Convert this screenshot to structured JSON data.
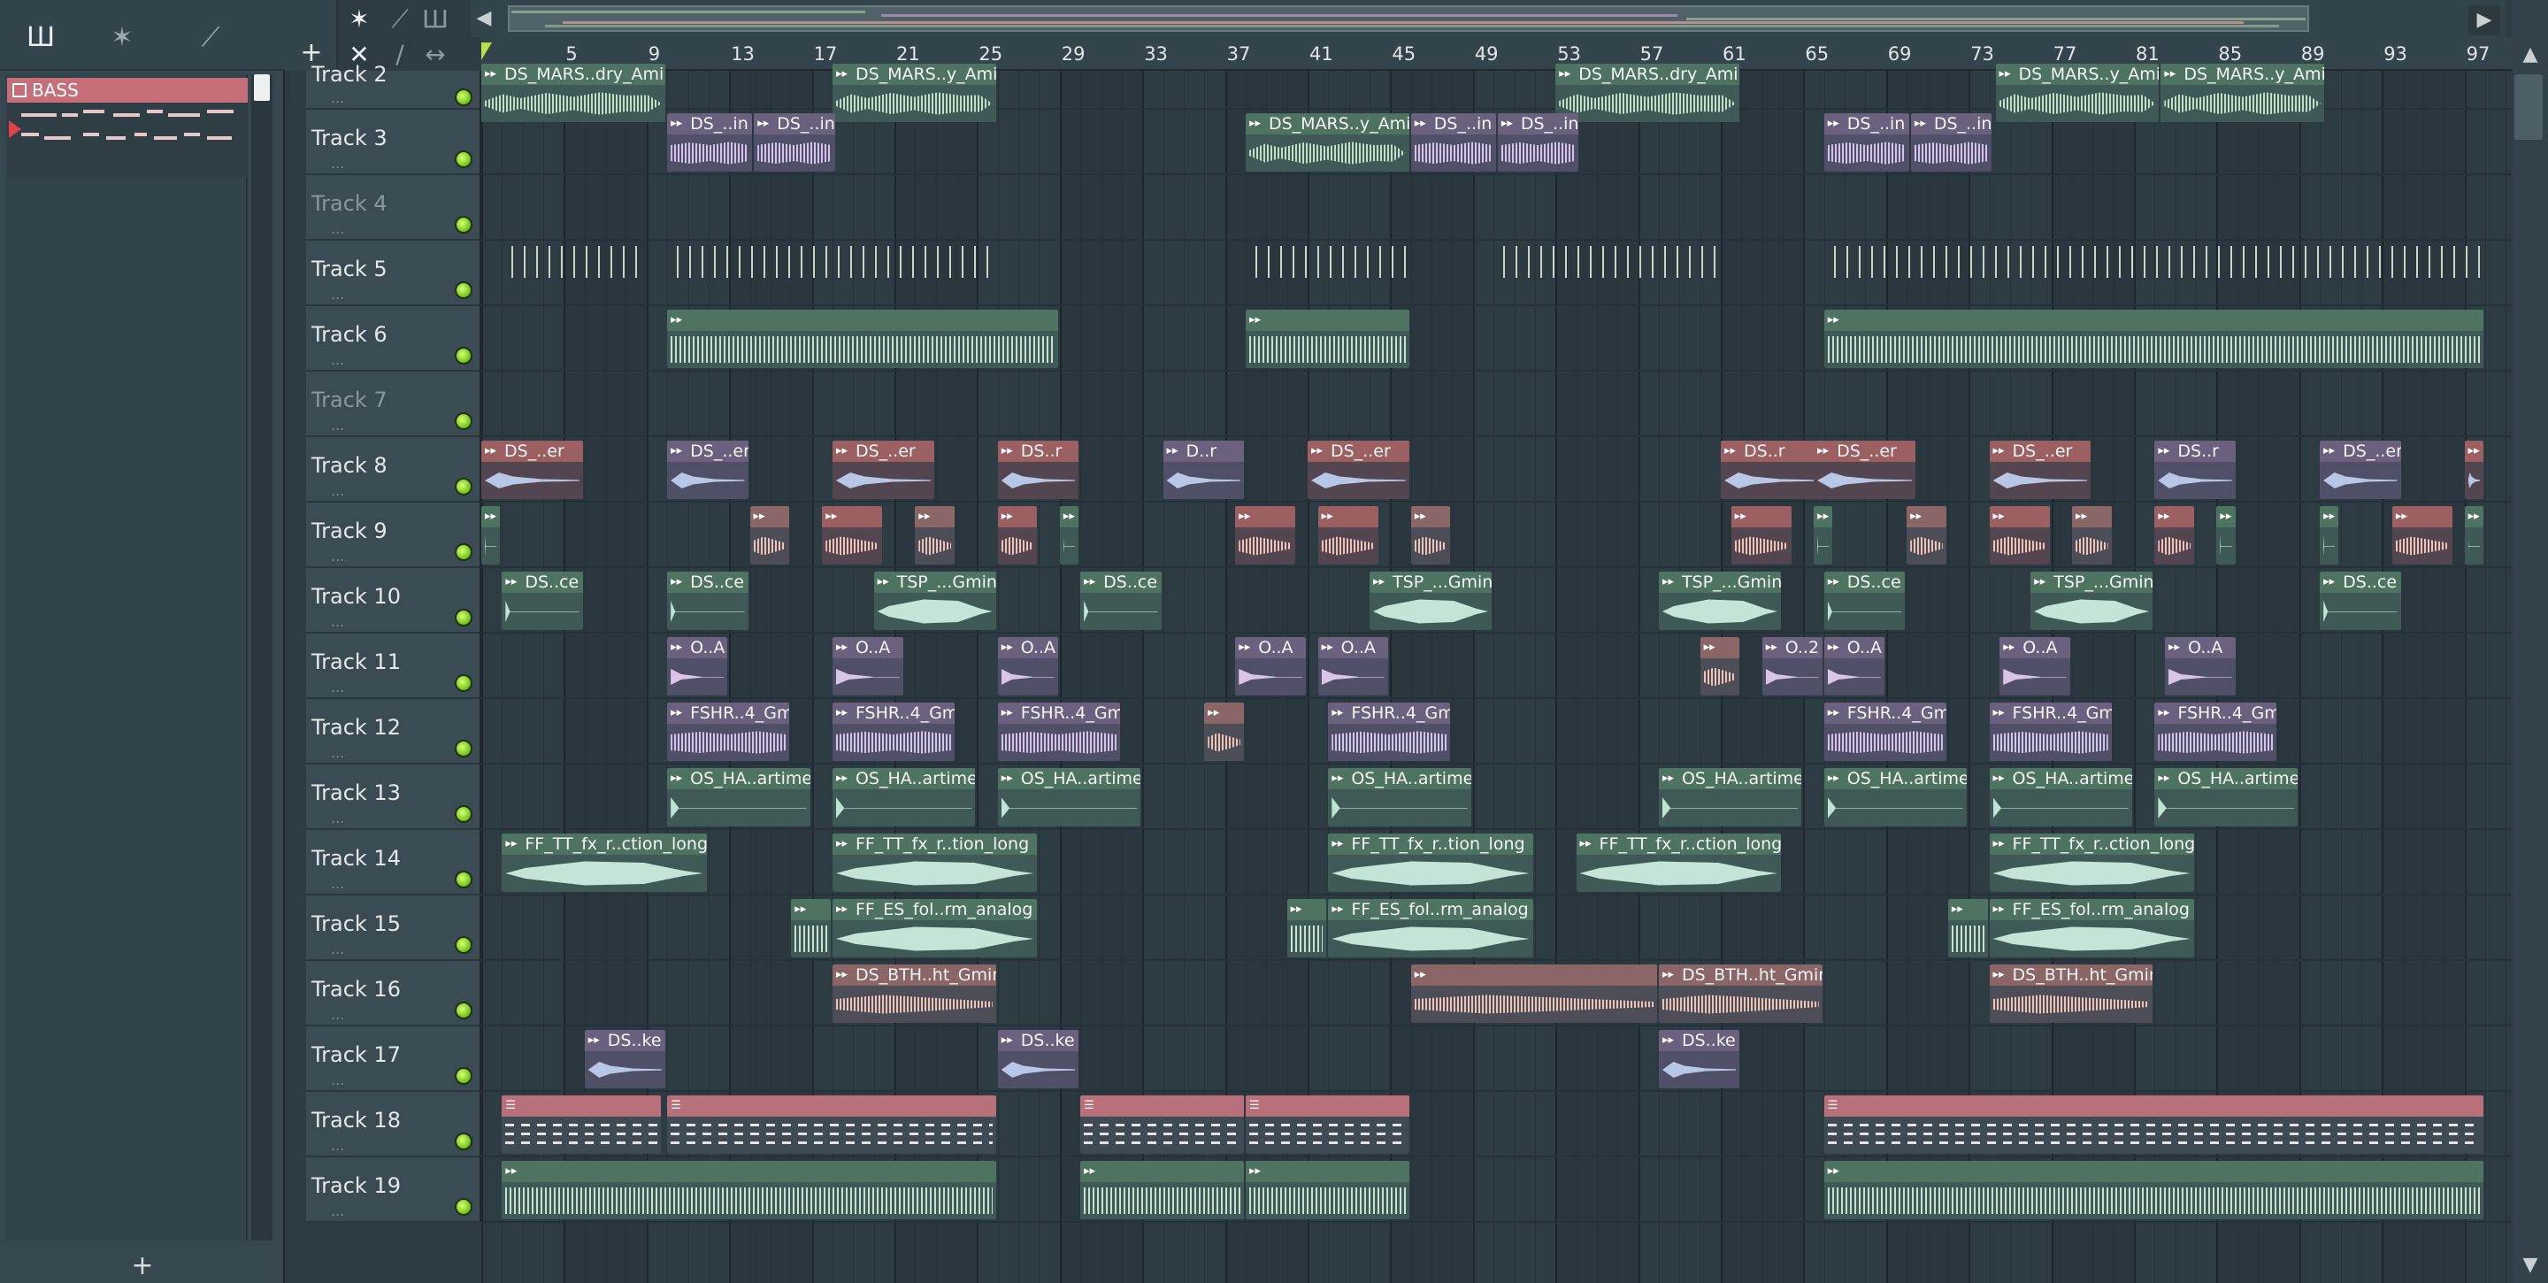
{
  "picker": {
    "tools": [
      "piano-roll",
      "audio",
      "automation"
    ],
    "pattern": {
      "name": "BASS"
    },
    "add_label": "+"
  },
  "playlist": {
    "tools_top": [
      "waveform-tool",
      "automation-tool",
      "piano-roll-tool"
    ],
    "tools_bottom": [
      "close",
      "draw",
      "slide"
    ],
    "add_label": "+",
    "ruler_bars": [
      "5",
      "9",
      "13",
      "17",
      "21",
      "25",
      "29",
      "33",
      "37",
      "41",
      "45",
      "49",
      "53",
      "57",
      "61",
      "65",
      "69",
      "73",
      "77",
      "81",
      "85",
      "89",
      "93",
      "97"
    ]
  },
  "tracks": [
    {
      "name": "Track 2",
      "muted": false,
      "clips": [
        {
          "start": 1,
          "len": 9,
          "label": "DS_MARS..dry_Amin",
          "color": "green",
          "wave": "green"
        },
        {
          "start": 18,
          "len": 8,
          "label": "DS_MARS..y_Amin",
          "color": "green",
          "wave": "green"
        },
        {
          "start": 53,
          "len": 9,
          "label": "DS_MARS..dry_Amin",
          "color": "green",
          "wave": "green"
        },
        {
          "start": 74.3,
          "len": 8,
          "label": "DS_MARS..y_Amin",
          "color": "green",
          "wave": "green"
        },
        {
          "start": 82.3,
          "len": 8,
          "label": "DS_MARS..y_Amin",
          "color": "green",
          "wave": "green"
        }
      ]
    },
    {
      "name": "Track 3",
      "muted": false,
      "clips": [
        {
          "start": 10,
          "len": 4.2,
          "label": "DS_..in",
          "color": "purple",
          "wave": "purple"
        },
        {
          "start": 14.2,
          "len": 4,
          "label": "DS_..in",
          "color": "purple",
          "wave": "purple"
        },
        {
          "start": 38,
          "len": 8,
          "label": "DS_MARS..y_Amin",
          "color": "green",
          "wave": "green"
        },
        {
          "start": 46,
          "len": 4.2,
          "label": "DS_..in",
          "color": "purple",
          "wave": "purple"
        },
        {
          "start": 50.2,
          "len": 4,
          "label": "DS_..in",
          "color": "purple",
          "wave": "purple"
        },
        {
          "start": 66,
          "len": 4.2,
          "label": "DS_..in",
          "color": "purple",
          "wave": "purple"
        },
        {
          "start": 70.2,
          "len": 4,
          "label": "DS_..in",
          "color": "purple",
          "wave": "purple"
        }
      ]
    },
    {
      "name": "Track 4",
      "muted": true,
      "clips": []
    },
    {
      "name": "Track 5",
      "muted": false,
      "clips": [
        {
          "start": 2.3,
          "len": 7,
          "label": "",
          "color": "blank",
          "wave": "ticks"
        },
        {
          "start": 10.3,
          "len": 16,
          "label": "",
          "color": "blank",
          "wave": "ticks"
        },
        {
          "start": 38.3,
          "len": 8,
          "label": "",
          "color": "blank",
          "wave": "ticks"
        },
        {
          "start": 50.3,
          "len": 11,
          "label": "",
          "color": "blank",
          "wave": "ticks"
        },
        {
          "start": 66.3,
          "len": 32,
          "label": "",
          "color": "blank",
          "wave": "ticks"
        }
      ]
    },
    {
      "name": "Track 6",
      "muted": false,
      "clips": [
        {
          "start": 10,
          "len": 19,
          "label": "",
          "color": "green",
          "wave": "dense"
        },
        {
          "start": 38,
          "len": 8,
          "label": "",
          "color": "green",
          "wave": "dense"
        },
        {
          "start": 66,
          "len": 32,
          "label": "",
          "color": "green",
          "wave": "dense"
        }
      ]
    },
    {
      "name": "Track 7",
      "muted": true,
      "clips": []
    },
    {
      "name": "Track 8",
      "muted": false,
      "clips": [
        {
          "start": 1,
          "len": 5,
          "label": "DS_..er",
          "color": "red",
          "wave": "blue"
        },
        {
          "start": 10,
          "len": 4,
          "label": "DS_..er",
          "color": "purple",
          "wave": "blue"
        },
        {
          "start": 18,
          "len": 5,
          "label": "DS_..er",
          "color": "red",
          "wave": "blue"
        },
        {
          "start": 26,
          "len": 4,
          "label": "DS..r",
          "color": "red",
          "wave": "blue"
        },
        {
          "start": 34,
          "len": 4,
          "label": "D..r",
          "color": "purple",
          "wave": "blue"
        },
        {
          "start": 41,
          "len": 5,
          "label": "DS_..er",
          "color": "red",
          "wave": "blue"
        },
        {
          "start": 61,
          "len": 5,
          "label": "DS..r",
          "color": "red",
          "wave": "blue"
        },
        {
          "start": 65.5,
          "len": 5,
          "label": "DS_..er",
          "color": "red",
          "wave": "blue"
        },
        {
          "start": 74,
          "len": 5,
          "label": "DS_..er",
          "color": "red",
          "wave": "blue"
        },
        {
          "start": 82,
          "len": 4,
          "label": "DS..r",
          "color": "purple",
          "wave": "blue"
        },
        {
          "start": 90,
          "len": 4,
          "label": "DS_..er",
          "color": "purple",
          "wave": "blue"
        },
        {
          "start": 97,
          "len": 1,
          "label": "",
          "color": "red",
          "wave": "blue"
        }
      ]
    },
    {
      "name": "Track 9",
      "muted": false,
      "clips": [
        {
          "start": 1,
          "len": 1,
          "label": "",
          "color": "green",
          "wave": "mint"
        },
        {
          "start": 14,
          "len": 2,
          "label": "",
          "color": "brown",
          "wave": "pink"
        },
        {
          "start": 17.5,
          "len": 3,
          "label": "",
          "color": "red",
          "wave": "pink"
        },
        {
          "start": 22,
          "len": 2,
          "label": "",
          "color": "brown",
          "wave": "pink"
        },
        {
          "start": 26,
          "len": 2,
          "label": "",
          "color": "red",
          "wave": "pink"
        },
        {
          "start": 29,
          "len": 1,
          "label": "",
          "color": "green",
          "wave": "mint"
        },
        {
          "start": 37.5,
          "len": 3,
          "label": "",
          "color": "red",
          "wave": "pink"
        },
        {
          "start": 41.5,
          "len": 3,
          "label": "",
          "color": "red",
          "wave": "pink"
        },
        {
          "start": 46,
          "len": 2,
          "label": "",
          "color": "brown",
          "wave": "pink"
        },
        {
          "start": 61.5,
          "len": 3,
          "label": "",
          "color": "red",
          "wave": "pink"
        },
        {
          "start": 65.5,
          "len": 1,
          "label": "",
          "color": "green",
          "wave": "mint"
        },
        {
          "start": 70,
          "len": 2,
          "label": "",
          "color": "brown",
          "wave": "pink"
        },
        {
          "start": 74,
          "len": 3,
          "label": "",
          "color": "red",
          "wave": "pink"
        },
        {
          "start": 78,
          "len": 2,
          "label": "",
          "color": "brown",
          "wave": "pink"
        },
        {
          "start": 82,
          "len": 2,
          "label": "",
          "color": "red",
          "wave": "pink"
        },
        {
          "start": 85,
          "len": 1,
          "label": "",
          "color": "green",
          "wave": "mint"
        },
        {
          "start": 90,
          "len": 1,
          "label": "",
          "color": "green",
          "wave": "mint"
        },
        {
          "start": 93.5,
          "len": 3,
          "label": "",
          "color": "red",
          "wave": "pink"
        },
        {
          "start": 97,
          "len": 1,
          "label": "",
          "color": "green",
          "wave": "mint"
        }
      ]
    },
    {
      "name": "Track 10",
      "muted": false,
      "clips": [
        {
          "start": 2,
          "len": 4,
          "label": "DS..ce",
          "color": "green",
          "wave": "mint"
        },
        {
          "start": 10,
          "len": 4,
          "label": "DS..ce",
          "color": "green",
          "wave": "mint"
        },
        {
          "start": 20,
          "len": 6,
          "label": "TSP_...Gmin",
          "color": "green",
          "wave": "swell"
        },
        {
          "start": 30,
          "len": 4,
          "label": "DS..ce",
          "color": "green",
          "wave": "mint"
        },
        {
          "start": 44,
          "len": 6,
          "label": "TSP_...Gmin",
          "color": "green",
          "wave": "swell"
        },
        {
          "start": 58,
          "len": 6,
          "label": "TSP_...Gmin",
          "color": "green",
          "wave": "swell"
        },
        {
          "start": 66,
          "len": 4,
          "label": "DS..ce",
          "color": "green",
          "wave": "mint"
        },
        {
          "start": 76,
          "len": 6,
          "label": "TSP_...Gmin",
          "color": "green",
          "wave": "swell"
        },
        {
          "start": 90,
          "len": 4,
          "label": "DS..ce",
          "color": "green",
          "wave": "mint"
        }
      ]
    },
    {
      "name": "Track 11",
      "muted": false,
      "clips": [
        {
          "start": 10,
          "len": 3,
          "label": "O..A",
          "color": "purple",
          "wave": "lilac"
        },
        {
          "start": 18,
          "len": 3.5,
          "label": "O..A",
          "color": "purple",
          "wave": "lilac"
        },
        {
          "start": 26,
          "len": 3,
          "label": "O..A",
          "color": "purple",
          "wave": "lilac"
        },
        {
          "start": 37.5,
          "len": 3.5,
          "label": "O..A",
          "color": "purple",
          "wave": "lilac"
        },
        {
          "start": 41.5,
          "len": 3.5,
          "label": "O..A",
          "color": "purple",
          "wave": "lilac"
        },
        {
          "start": 60,
          "len": 2,
          "label": "",
          "color": "brown",
          "wave": "pink"
        },
        {
          "start": 63,
          "len": 3,
          "label": "O..2",
          "color": "purple",
          "wave": "lilac"
        },
        {
          "start": 66,
          "len": 3,
          "label": "O..A",
          "color": "purple",
          "wave": "lilac"
        },
        {
          "start": 74.5,
          "len": 3.5,
          "label": "O..A",
          "color": "purple",
          "wave": "lilac"
        },
        {
          "start": 82.5,
          "len": 3.5,
          "label": "O..A",
          "color": "purple",
          "wave": "lilac"
        }
      ]
    },
    {
      "name": "Track 12",
      "muted": false,
      "clips": [
        {
          "start": 10,
          "len": 6,
          "label": "FSHR..4_Gm",
          "color": "purple",
          "wave": "purple"
        },
        {
          "start": 18,
          "len": 6,
          "label": "FSHR..4_Gm",
          "color": "purple",
          "wave": "purple"
        },
        {
          "start": 26,
          "len": 6,
          "label": "FSHR..4_Gm",
          "color": "purple",
          "wave": "purple"
        },
        {
          "start": 36,
          "len": 2,
          "label": "",
          "color": "brown",
          "wave": "pink"
        },
        {
          "start": 42,
          "len": 6,
          "label": "FSHR..4_Gm",
          "color": "purple",
          "wave": "purple"
        },
        {
          "start": 66,
          "len": 6,
          "label": "FSHR..4_Gm",
          "color": "purple",
          "wave": "purple"
        },
        {
          "start": 74,
          "len": 6,
          "label": "FSHR..4_Gm",
          "color": "purple",
          "wave": "purple"
        },
        {
          "start": 82,
          "len": 6,
          "label": "FSHR..4_Gm",
          "color": "purple",
          "wave": "purple"
        }
      ]
    },
    {
      "name": "Track 13",
      "muted": false,
      "clips": [
        {
          "start": 10,
          "len": 7,
          "label": "OS_HA..artime",
          "color": "green",
          "wave": "mint"
        },
        {
          "start": 18,
          "len": 7,
          "label": "OS_HA..artime",
          "color": "green",
          "wave": "mint"
        },
        {
          "start": 26,
          "len": 7,
          "label": "OS_HA..artime",
          "color": "green",
          "wave": "mint"
        },
        {
          "start": 42,
          "len": 7,
          "label": "OS_HA..artime",
          "color": "green",
          "wave": "mint"
        },
        {
          "start": 58,
          "len": 7,
          "label": "OS_HA..artime",
          "color": "green",
          "wave": "mint"
        },
        {
          "start": 66,
          "len": 7,
          "label": "OS_HA..artime",
          "color": "green",
          "wave": "mint"
        },
        {
          "start": 74,
          "len": 7,
          "label": "OS_HA..artime",
          "color": "green",
          "wave": "mint"
        },
        {
          "start": 82,
          "len": 7,
          "label": "OS_HA..artime",
          "color": "green",
          "wave": "mint"
        }
      ]
    },
    {
      "name": "Track 14",
      "muted": false,
      "clips": [
        {
          "start": 2,
          "len": 10,
          "label": "FF_TT_fx_r..ction_long",
          "color": "green",
          "wave": "swell"
        },
        {
          "start": 18,
          "len": 10,
          "label": "FF_TT_fx_r..tion_long",
          "color": "green",
          "wave": "swell"
        },
        {
          "start": 42,
          "len": 10,
          "label": "FF_TT_fx_r..tion_long",
          "color": "green",
          "wave": "swell"
        },
        {
          "start": 54,
          "len": 10,
          "label": "FF_TT_fx_r..ction_long",
          "color": "green",
          "wave": "swell"
        },
        {
          "start": 74,
          "len": 10,
          "label": "FF_TT_fx_r..ction_long",
          "color": "green",
          "wave": "swell"
        }
      ]
    },
    {
      "name": "Track 15",
      "muted": false,
      "clips": [
        {
          "start": 16,
          "len": 2,
          "label": "",
          "color": "green",
          "wave": "dense"
        },
        {
          "start": 18,
          "len": 10,
          "label": "FF_ES_fol..rm_analog",
          "color": "green",
          "wave": "swell"
        },
        {
          "start": 40,
          "len": 2,
          "label": "",
          "color": "green",
          "wave": "dense"
        },
        {
          "start": 42,
          "len": 10,
          "label": "FF_ES_fol..rm_analog",
          "color": "green",
          "wave": "swell"
        },
        {
          "start": 72,
          "len": 2,
          "label": "",
          "color": "green",
          "wave": "dense"
        },
        {
          "start": 74,
          "len": 10,
          "label": "FF_ES_fol..rm_analog",
          "color": "green",
          "wave": "swell"
        }
      ]
    },
    {
      "name": "Track 16",
      "muted": false,
      "clips": [
        {
          "start": 18,
          "len": 8,
          "label": "DS_BTH..ht_Gmin",
          "color": "brown",
          "wave": "pink"
        },
        {
          "start": 46,
          "len": 12,
          "label": "",
          "color": "brown",
          "wave": "pink"
        },
        {
          "start": 58,
          "len": 8,
          "label": "DS_BTH..ht_Gmin",
          "color": "brown",
          "wave": "pink"
        },
        {
          "start": 74,
          "len": 8,
          "label": "DS_BTH..ht_Gmin",
          "color": "brown",
          "wave": "pink"
        }
      ]
    },
    {
      "name": "Track 17",
      "muted": false,
      "clips": [
        {
          "start": 6,
          "len": 4,
          "label": "DS..ke",
          "color": "purple",
          "wave": "blue"
        },
        {
          "start": 26,
          "len": 4,
          "label": "DS..ke",
          "color": "purple",
          "wave": "blue"
        },
        {
          "start": 58,
          "len": 4,
          "label": "DS..ke",
          "color": "purple",
          "wave": "blue"
        }
      ]
    },
    {
      "name": "Track 18",
      "muted": false,
      "clips": [
        {
          "start": 2,
          "len": 7.8,
          "label": "",
          "color": "pink",
          "wave": "midi"
        },
        {
          "start": 10,
          "len": 16,
          "label": "",
          "color": "pink",
          "wave": "midi"
        },
        {
          "start": 30,
          "len": 8,
          "label": "",
          "color": "pink",
          "wave": "midi"
        },
        {
          "start": 38,
          "len": 8,
          "label": "",
          "color": "pink",
          "wave": "midi"
        },
        {
          "start": 66,
          "len": 32,
          "label": "",
          "color": "pink",
          "wave": "midi"
        }
      ]
    },
    {
      "name": "Track 19",
      "muted": false,
      "clips": [
        {
          "start": 2,
          "len": 24,
          "label": "",
          "color": "green",
          "wave": "dense"
        },
        {
          "start": 30,
          "len": 8,
          "label": "",
          "color": "green",
          "wave": "dense"
        },
        {
          "start": 38,
          "len": 8,
          "label": "",
          "color": "green",
          "wave": "dense"
        },
        {
          "start": 66,
          "len": 32,
          "label": "",
          "color": "green",
          "wave": "dense"
        }
      ]
    }
  ]
}
